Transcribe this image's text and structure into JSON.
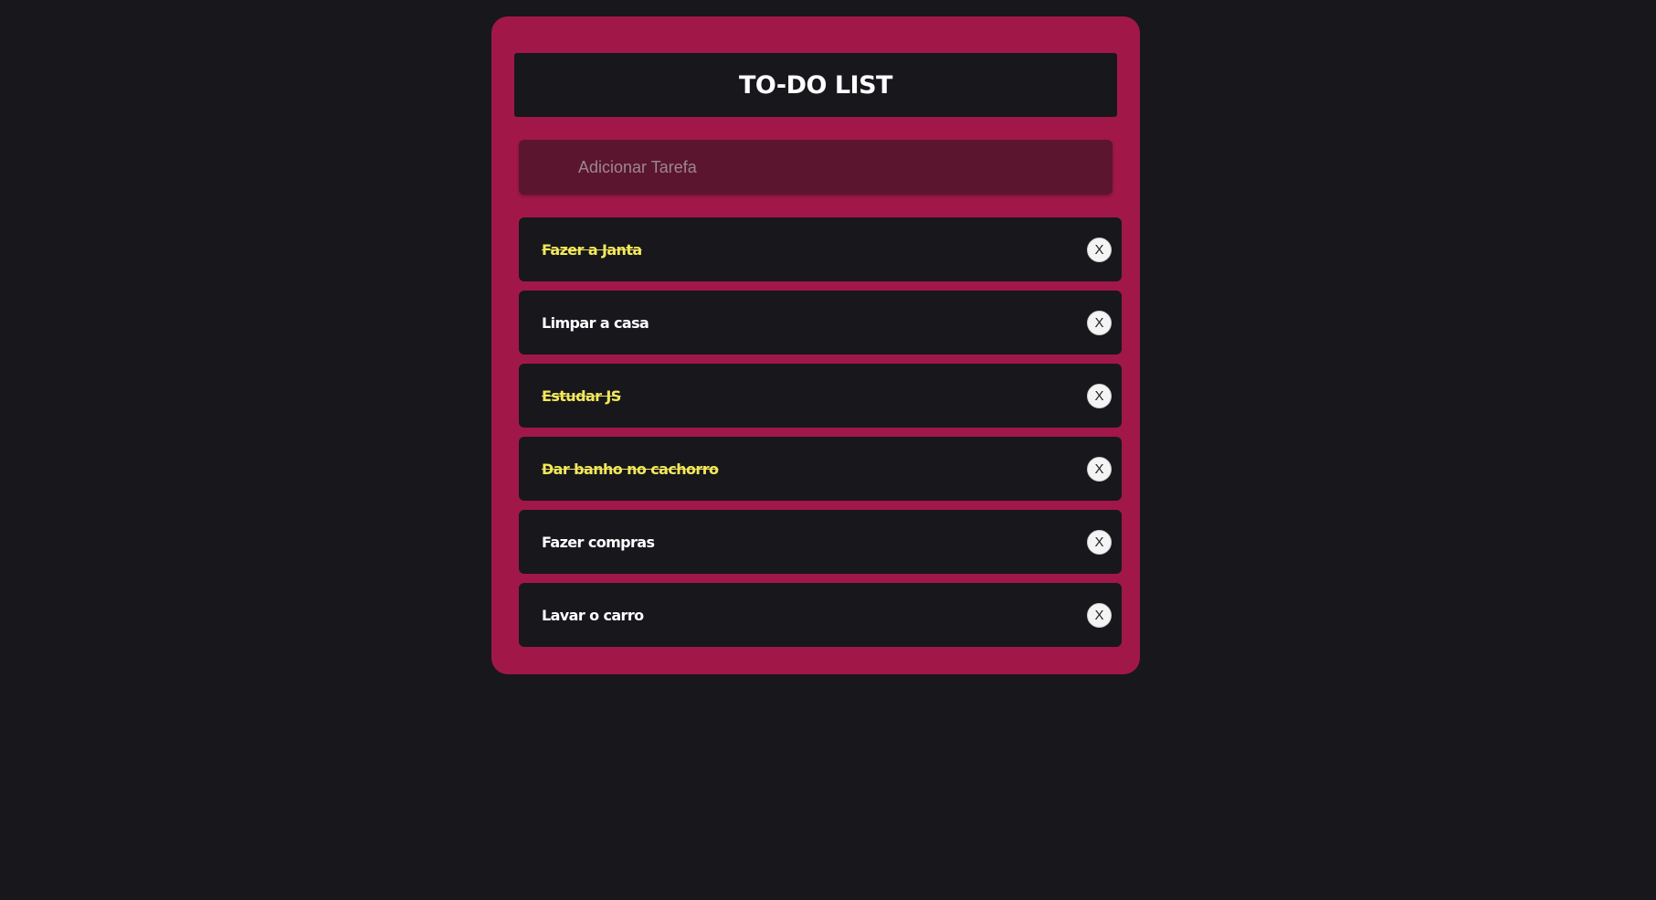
{
  "header": {
    "title": "TO-DO LIST"
  },
  "input": {
    "placeholder": "Adicionar Tarefa",
    "value": ""
  },
  "tasks": [
    {
      "text": "Fazer a Janta",
      "done": true,
      "delete_label": "X"
    },
    {
      "text": "Limpar a casa",
      "done": false,
      "delete_label": "X"
    },
    {
      "text": "Estudar JS",
      "done": true,
      "delete_label": "X"
    },
    {
      "text": "Dar banho no cachorro",
      "done": true,
      "delete_label": "X"
    },
    {
      "text": "Fazer compras",
      "done": false,
      "delete_label": "X"
    },
    {
      "text": "Lavar o carro",
      "done": false,
      "delete_label": "X"
    }
  ],
  "colors": {
    "background": "#18171c",
    "card": "#a11848",
    "input_bg": "#5b152f",
    "done_text": "#f2e85a",
    "text": "#ffffff"
  }
}
